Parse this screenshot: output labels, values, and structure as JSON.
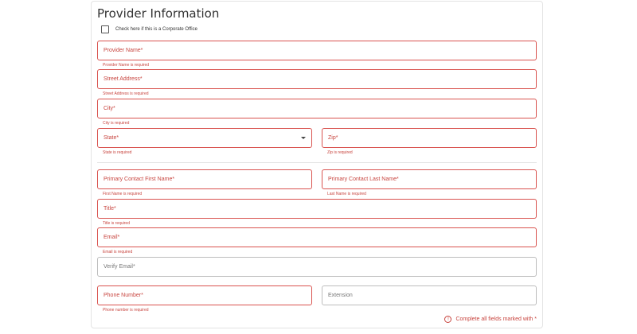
{
  "section": {
    "title": "Provider Information",
    "corporate_label": "Check here if this is a Corporate Office"
  },
  "fields": {
    "provider_name": {
      "label": "Provider Name*",
      "error": "Provider Name is required"
    },
    "street_address": {
      "label": "Street Address*",
      "error": "Street Address is required"
    },
    "city": {
      "label": "City*",
      "error": "City is required"
    },
    "state": {
      "label": "State*",
      "error": "State is required"
    },
    "zip": {
      "label": "Zip*",
      "error": "Zip is required"
    },
    "first_name": {
      "label": "Primary Contact First Name*",
      "error": "First Name is required"
    },
    "last_name": {
      "label": "Primary Contact Last Name*",
      "error": "Last Name is required"
    },
    "title": {
      "label": "Title*",
      "error": "Title is required"
    },
    "email": {
      "label": "Email*",
      "error": "Email is required"
    },
    "verify_email": {
      "label": "Verify Email*"
    },
    "phone": {
      "label": "Phone Number*",
      "error": "Phone number is required"
    },
    "extension": {
      "label": "Extension"
    }
  },
  "footer": {
    "note": "Complete all fields marked with *"
  },
  "colors": {
    "error": "#c8453f",
    "border_error": "#d9534f",
    "border_ok": "#bdbdbd"
  }
}
